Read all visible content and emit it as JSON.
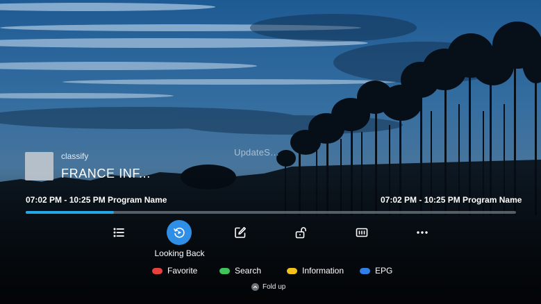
{
  "watermark": "UpdateS…",
  "channel": {
    "classify": "classify",
    "name": "FRANCE  INF..."
  },
  "program": {
    "current": "07:02 PM  -  10:25 PM Program Name",
    "next": "07:02 PM  -  10:25 PM Program Name"
  },
  "progress": {
    "fraction": 0.18
  },
  "toolbar": {
    "items": [
      {
        "icon": "list-icon"
      },
      {
        "icon": "replay-icon",
        "label": "Looking Back",
        "active": true
      },
      {
        "icon": "edit-icon"
      },
      {
        "icon": "unlock-icon"
      },
      {
        "icon": "subtitles-icon"
      },
      {
        "icon": "more-icon"
      }
    ]
  },
  "legend": [
    {
      "label": "Favorite",
      "color": "#e8403c"
    },
    {
      "label": "Search",
      "color": "#3fc35a"
    },
    {
      "label": "Information",
      "color": "#f2c21b"
    },
    {
      "label": "EPG",
      "color": "#2f7fe6"
    }
  ],
  "fold": {
    "label": "Fold up"
  },
  "colors": {
    "accent": "#2f8fe6",
    "progress": "#23a8e6"
  }
}
